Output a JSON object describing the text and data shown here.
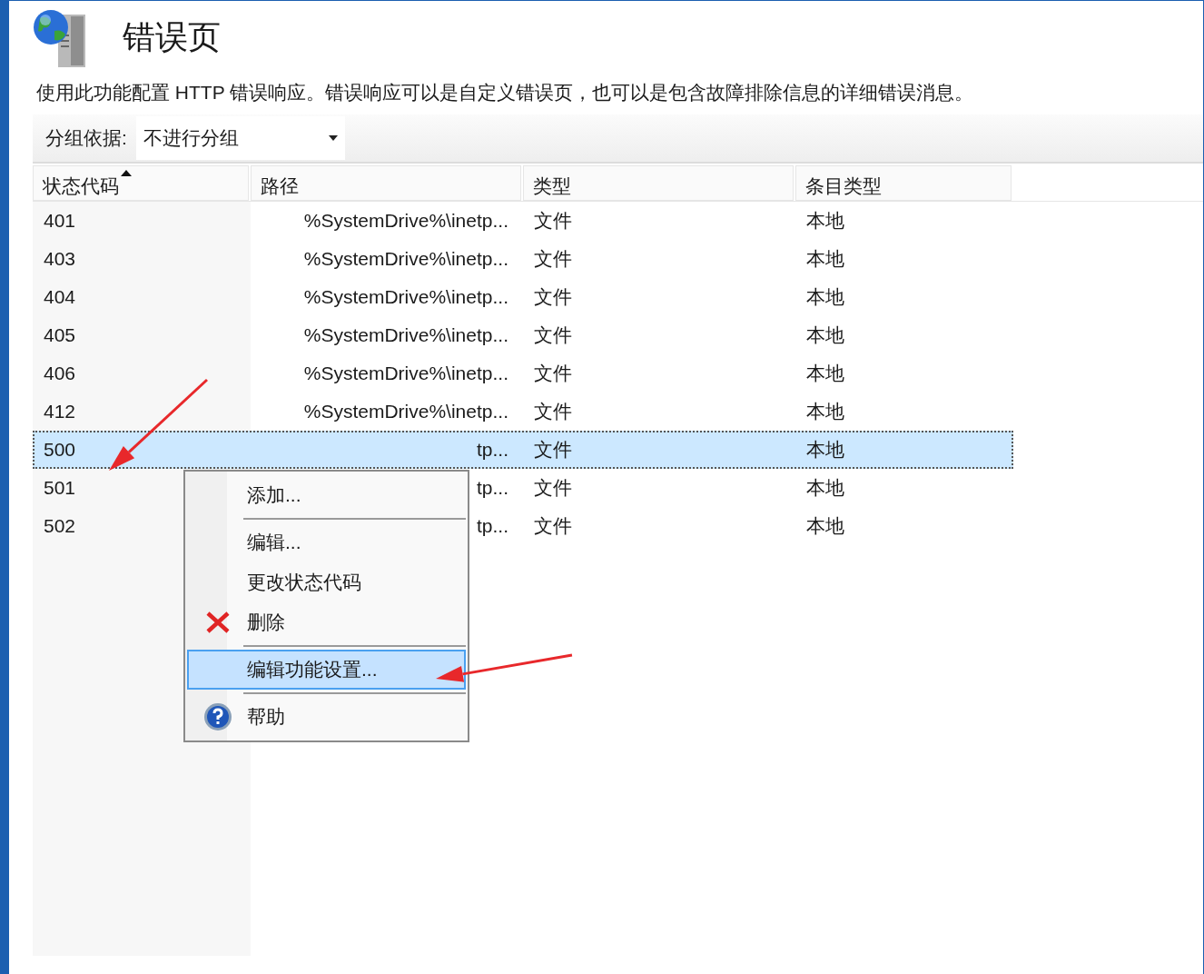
{
  "page": {
    "title": "错误页",
    "description": "使用此功能配置 HTTP 错误响应。错误响应可以是自定义错误页，也可以是包含故障排除信息的详细错误消息。"
  },
  "group_by": {
    "label": "分组依据:",
    "value": "不进行分组"
  },
  "table": {
    "columns": [
      {
        "label": "状态代码",
        "sorted": true
      },
      {
        "label": "路径",
        "sorted": false
      },
      {
        "label": "类型",
        "sorted": false
      },
      {
        "label": "条目类型",
        "sorted": false
      }
    ],
    "rows": [
      {
        "status_code": "401",
        "path": "%SystemDrive%\\inetp...",
        "type": "文件",
        "entry_type": "本地",
        "selected": false
      },
      {
        "status_code": "403",
        "path": "%SystemDrive%\\inetp...",
        "type": "文件",
        "entry_type": "本地",
        "selected": false
      },
      {
        "status_code": "404",
        "path": "%SystemDrive%\\inetp...",
        "type": "文件",
        "entry_type": "本地",
        "selected": false
      },
      {
        "status_code": "405",
        "path": "%SystemDrive%\\inetp...",
        "type": "文件",
        "entry_type": "本地",
        "selected": false
      },
      {
        "status_code": "406",
        "path": "%SystemDrive%\\inetp...",
        "type": "文件",
        "entry_type": "本地",
        "selected": false
      },
      {
        "status_code": "412",
        "path": "%SystemDrive%\\inetp...",
        "type": "文件",
        "entry_type": "本地",
        "selected": false
      },
      {
        "status_code": "500",
        "path": "tp...",
        "type": "文件",
        "entry_type": "本地",
        "selected": true
      },
      {
        "status_code": "501",
        "path": "tp...",
        "type": "文件",
        "entry_type": "本地",
        "selected": false
      },
      {
        "status_code": "502",
        "path": "tp...",
        "type": "文件",
        "entry_type": "本地",
        "selected": false
      }
    ]
  },
  "context_menu": {
    "items": [
      {
        "kind": "item",
        "label": "添加...",
        "selected": false
      },
      {
        "kind": "separator"
      },
      {
        "kind": "item",
        "label": "编辑...",
        "selected": false
      },
      {
        "kind": "item",
        "label": "更改状态代码",
        "selected": false
      },
      {
        "kind": "delete",
        "label": "删除",
        "selected": false
      },
      {
        "kind": "separator"
      },
      {
        "kind": "item",
        "label": "编辑功能设置...",
        "selected": true
      },
      {
        "kind": "separator"
      },
      {
        "kind": "help",
        "label": "帮助",
        "selected": false
      }
    ]
  }
}
